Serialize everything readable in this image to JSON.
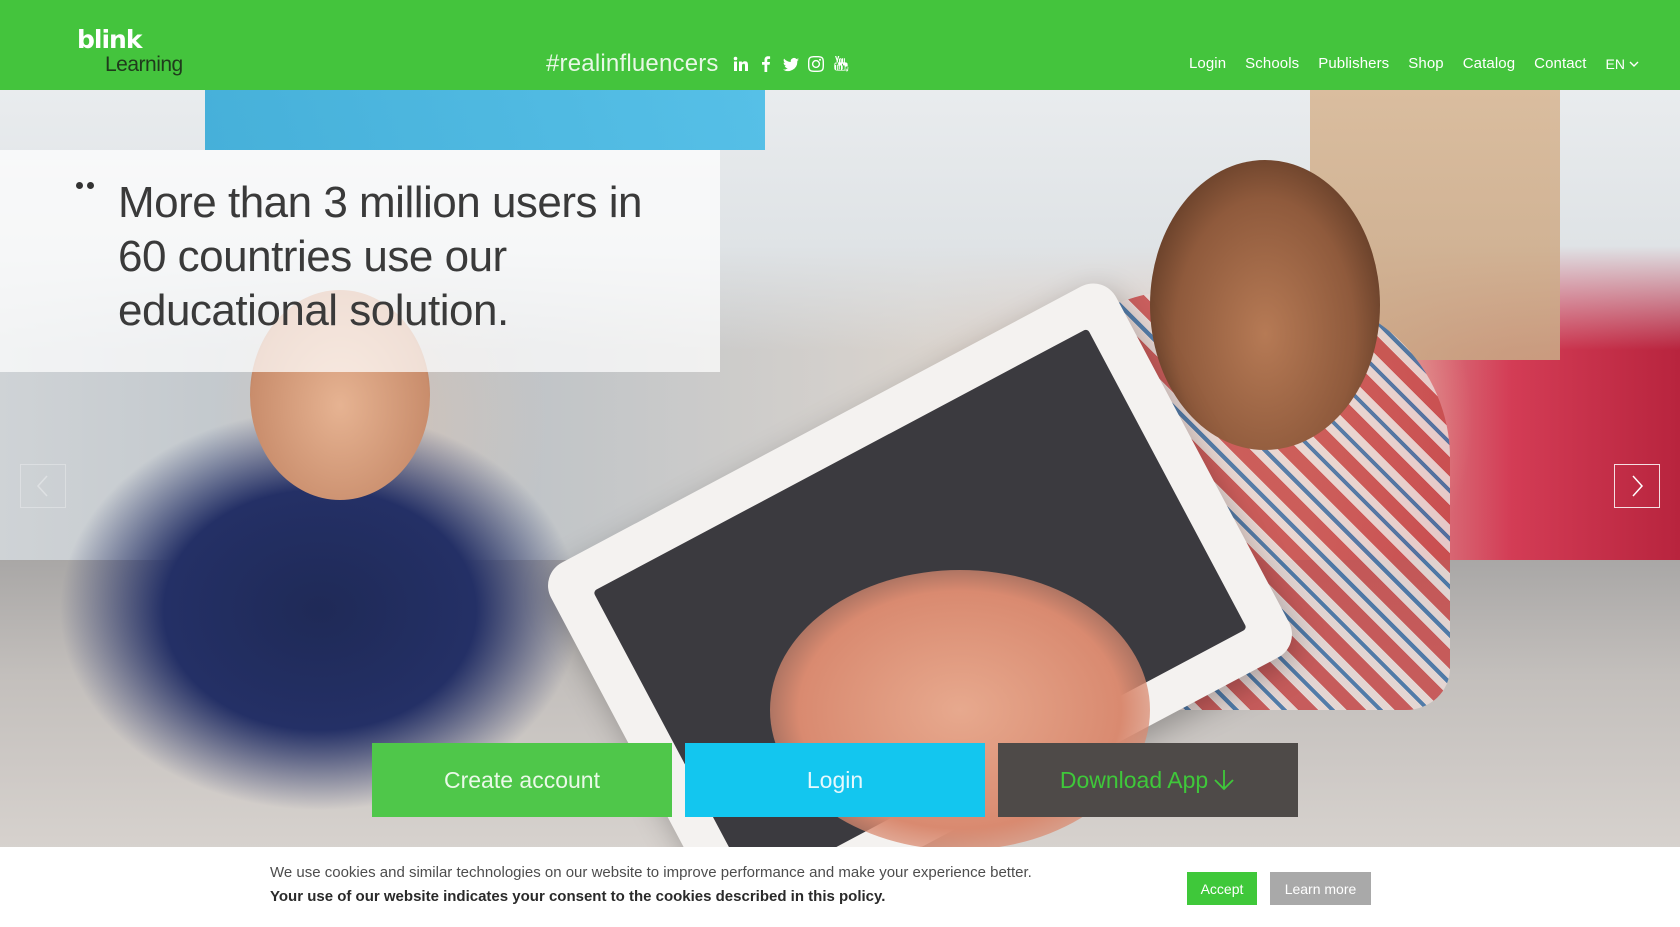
{
  "header": {
    "logo": {
      "line1": "blink",
      "line2": "Learning"
    },
    "hashtag": "#realinfluencers",
    "socials": [
      {
        "icon": "linkedin-icon"
      },
      {
        "icon": "facebook-icon"
      },
      {
        "icon": "twitter-icon"
      },
      {
        "icon": "instagram-icon"
      },
      {
        "icon": "youtube-icon"
      }
    ],
    "nav": {
      "login": "Login",
      "schools": "Schools",
      "publishers": "Publishers",
      "shop": "Shop",
      "catalog": "Catalog",
      "contact": "Contact",
      "language": "EN"
    }
  },
  "hero": {
    "quote": "More than 3 million users in 60 countries use our educational solution.",
    "buttons": {
      "create_account": "Create account",
      "login": "Login",
      "download_app": "Download App"
    }
  },
  "cookie": {
    "text": "We use cookies and similar technologies on our website to improve performance and make your experience better.",
    "consent": "Your use of our website indicates your consent to the cookies described in this policy.",
    "accept": "Accept",
    "learn_more": "Learn more"
  },
  "colors": {
    "brand_green": "#44c43d",
    "login_blue": "#13c6ef",
    "download_dark": "#4e4a48"
  }
}
